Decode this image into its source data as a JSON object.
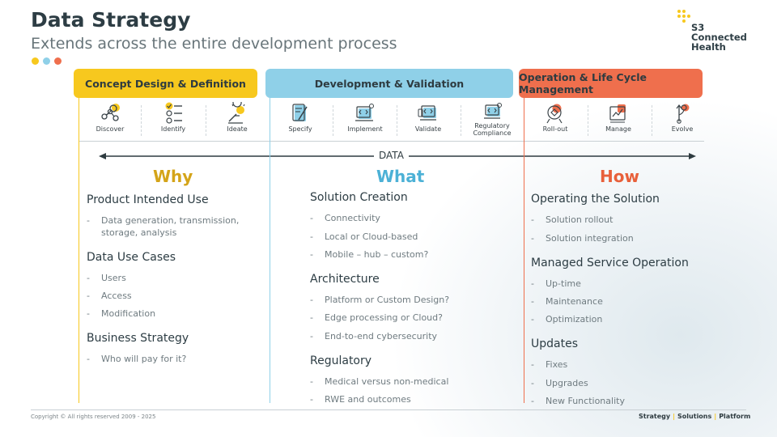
{
  "header": {
    "title": "Data Strategy",
    "subtitle": "Extends across the entire development process",
    "dot_colors": [
      "#f7c81e",
      "#8fd0e8",
      "#ef6f4d"
    ]
  },
  "logo": {
    "line1": "S3",
    "line2": "Connected",
    "line3": "Health"
  },
  "phases": [
    {
      "label": "Concept Design & Definition",
      "color": "#f7c81e"
    },
    {
      "label": "Development & Validation",
      "color": "#8fd0e8"
    },
    {
      "label": "Operation & Life Cycle Management",
      "color": "#ef6f4d"
    }
  ],
  "steps": [
    {
      "label": "Discover",
      "icon": "discover-icon"
    },
    {
      "label": "Identify",
      "icon": "identify-icon"
    },
    {
      "label": "Ideate",
      "icon": "ideate-icon"
    },
    {
      "label": "Specify",
      "icon": "specify-icon"
    },
    {
      "label": "Implement",
      "icon": "implement-icon"
    },
    {
      "label": "Validate",
      "icon": "validate-icon"
    },
    {
      "label": "Regulatory",
      "label2": "Compliance",
      "icon": "regulatory-compliance-icon"
    },
    {
      "label": "Roll-out",
      "icon": "roll-out-icon"
    },
    {
      "label": "Manage",
      "icon": "manage-icon"
    },
    {
      "label": "Evolve",
      "icon": "evolve-icon"
    }
  ],
  "data_arrow_label": "DATA",
  "columns": {
    "why": {
      "heading": "Why",
      "sections": [
        {
          "title": "Product Intended Use",
          "items": [
            "Data generation, transmission,",
            "storage, analysis"
          ]
        },
        {
          "title": "Data Use Cases",
          "items": [
            "Users",
            "Access",
            "Modification"
          ]
        },
        {
          "title": "Business Strategy",
          "items": [
            "Who will pay for it?"
          ]
        }
      ]
    },
    "what": {
      "heading": "What",
      "sections": [
        {
          "title": "Solution Creation",
          "items": [
            "Connectivity",
            "Local or Cloud-based",
            "Mobile – hub – custom?"
          ]
        },
        {
          "title": "Architecture",
          "items": [
            "Platform or Custom Design?",
            "Edge processing or Cloud?",
            "End-to-end cybersecurity"
          ]
        },
        {
          "title": "Regulatory",
          "items": [
            "Medical versus non-medical",
            "RWE and outcomes"
          ]
        }
      ]
    },
    "how": {
      "heading": "How",
      "sections": [
        {
          "title": "Operating the Solution",
          "items": [
            "Solution rollout",
            "Solution integration"
          ]
        },
        {
          "title": "Managed Service Operation",
          "items": [
            "Up-time",
            "Maintenance",
            "Optimization"
          ]
        },
        {
          "title": "Updates",
          "items": [
            "Fixes",
            "Upgrades",
            "New Functionality"
          ]
        }
      ]
    }
  },
  "footer": {
    "copyright": "Copyright © All rights reserved 2009 - 2025",
    "tag1": "Strategy",
    "tag2": "Solutions",
    "tag3": "Platform",
    "separator": "|"
  }
}
